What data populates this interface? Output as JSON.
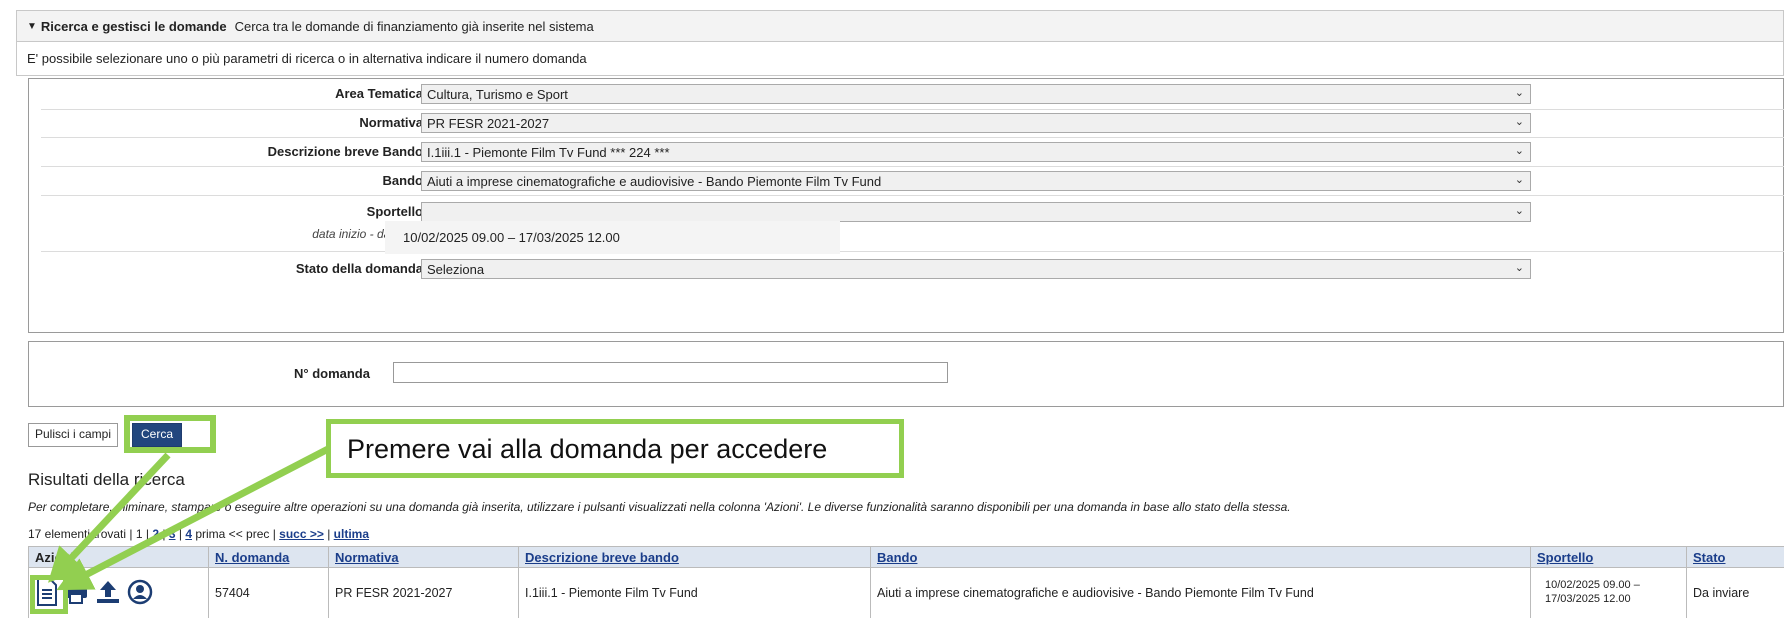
{
  "section": {
    "title": "Ricerca e gestisci le domande",
    "subtitle": "Cerca tra le domande di finanziamento già inserite nel sistema",
    "intro": "E' possibile selezionare uno o più parametri di ricerca o in alternativa indicare il numero domanda"
  },
  "filters": {
    "area_tematica": {
      "label": "Area Tematica",
      "value": "Cultura, Turismo e Sport"
    },
    "normativa": {
      "label": "Normativa",
      "value": "PR FESR 2021-2027"
    },
    "descrizione_bando": {
      "label": "Descrizione breve Bando",
      "value": "I.1iii.1 - Piemonte Film Tv Fund *** 224 ***"
    },
    "bando": {
      "label": "Bando",
      "value": "Aiuti a imprese cinematografiche e audiovisive - Bando Piemonte Film Tv Fund"
    },
    "sportello": {
      "label": "Sportello",
      "sublabel": "data inizio - data fine",
      "value": "",
      "popup": "10/02/2025 09.00 – 17/03/2025 12.00"
    },
    "stato": {
      "label": "Stato della domanda",
      "value": "Seleziona"
    }
  },
  "ndomanda": {
    "label": "N° domanda",
    "value": ""
  },
  "buttons": {
    "clear": "Pulisci i campi",
    "search": "Cerca"
  },
  "callout": "Premere vai alla domanda per accedere",
  "results": {
    "title": "Risultati della ricerca",
    "description": "Per completare, eliminare, stampare o eseguire altre operazioni su una domanda già inserita, utilizzare i pulsanti visualizzati nella colonna 'Azioni'. Le diverse funzionalità saranno disponibili per una domanda in base allo stato della stessa.",
    "pager": {
      "found": "17 elementi trovati",
      "current": "1",
      "pages": [
        "2",
        "3",
        "4"
      ],
      "first_prev": "prima << prec |",
      "next": "succ >>",
      "last": "ultima"
    },
    "columns": [
      "Azioni",
      "N. domanda",
      "Normativa",
      "Descrizione breve bando",
      "Bando",
      "Sportello",
      "Stato"
    ],
    "rows": [
      {
        "n_domanda": "57404",
        "normativa": "PR FESR 2021-2027",
        "descrizione": "I.1iii.1 - Piemonte Film Tv Fund",
        "bando": "Aiuti a imprese cinematografiche e audiovisive - Bando Piemonte Film Tv Fund",
        "sportello": "10/02/2025 09.00 – 17/03/2025 12.00",
        "stato": "Da inviare"
      }
    ]
  },
  "colors": {
    "highlight": "#92cf50",
    "button": "#22467e",
    "link": "#1a3d8a",
    "table_header": "#dde5f0"
  }
}
